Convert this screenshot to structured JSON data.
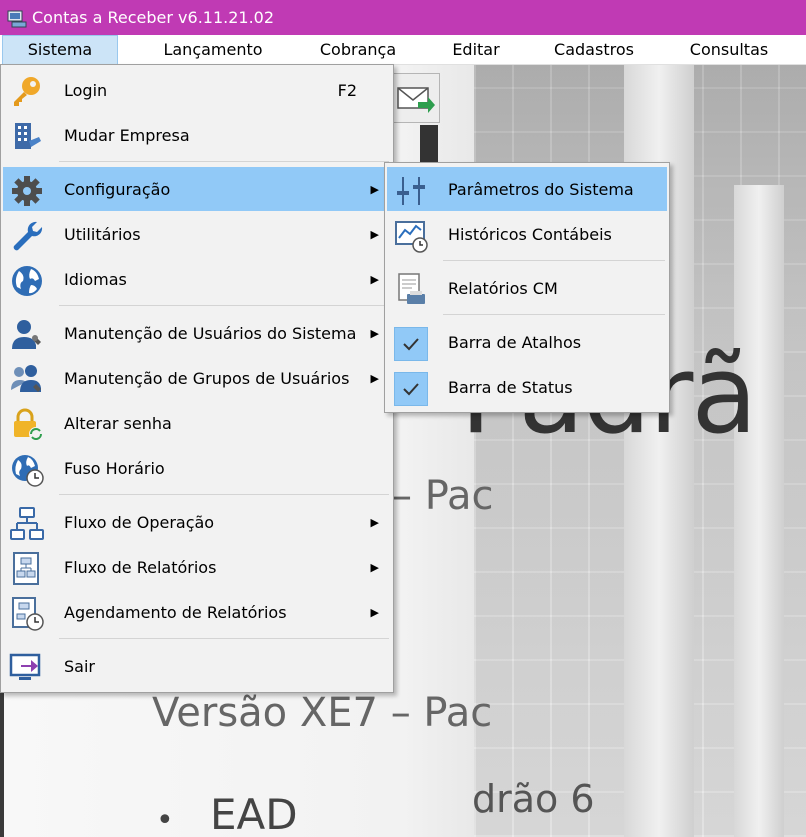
{
  "window": {
    "title": "Contas a Receber v6.11.21.02"
  },
  "menubar": {
    "items": [
      {
        "label": "Sistema"
      },
      {
        "label": "Lançamento"
      },
      {
        "label": "Cobrança"
      },
      {
        "label": "Editar"
      },
      {
        "label": "Cadastros"
      },
      {
        "label": "Consultas"
      }
    ]
  },
  "sistema_menu": {
    "items": [
      {
        "label": "Login",
        "shortcut": "F2",
        "icon": "key-icon"
      },
      {
        "label": "Mudar Empresa",
        "icon": "building-icon"
      },
      {
        "label": "Configuração",
        "icon": "gear-icon",
        "submenu": true
      },
      {
        "label": "Utilitários",
        "icon": "wrench-icon",
        "submenu": true
      },
      {
        "label": "Idiomas",
        "icon": "globe-icon",
        "submenu": true
      },
      {
        "label": "Manutenção de Usuários do Sistema",
        "icon": "user-wrench-icon",
        "submenu": true
      },
      {
        "label": "Manutenção de Grupos de Usuários",
        "icon": "group-wrench-icon",
        "submenu": true
      },
      {
        "label": "Alterar senha",
        "icon": "lock-refresh-icon"
      },
      {
        "label": "Fuso Horário",
        "icon": "globe-clock-icon"
      },
      {
        "label": "Fluxo de Operação",
        "icon": "flowchart-icon",
        "submenu": true
      },
      {
        "label": "Fluxo de Relatórios",
        "icon": "report-flow-icon",
        "submenu": true
      },
      {
        "label": "Agendamento de Relatórios",
        "icon": "report-clock-icon",
        "submenu": true
      },
      {
        "label": "Sair",
        "icon": "exit-icon"
      }
    ]
  },
  "configuracao_submenu": {
    "items": [
      {
        "label": "Parâmetros do Sistema",
        "icon": "sliders-icon"
      },
      {
        "label": "Históricos Contábeis",
        "icon": "chart-clock-icon"
      },
      {
        "label": "Relatórios CM",
        "icon": "report-printer-icon"
      },
      {
        "label": "Barra de Atalhos",
        "checked": true
      },
      {
        "label": "Barra de Status",
        "checked": true
      }
    ]
  },
  "background": {
    "big_word": "Padrã",
    "line1": "– Pac",
    "line2": "Versão XE7 – Pac",
    "line3": "drão 6",
    "bullet_text": "EAD",
    "bullet_char": "•"
  },
  "colors": {
    "titlebar": "#c03ab4",
    "highlight": "#91c9f7",
    "menu_bg": "#f2f2f2"
  }
}
